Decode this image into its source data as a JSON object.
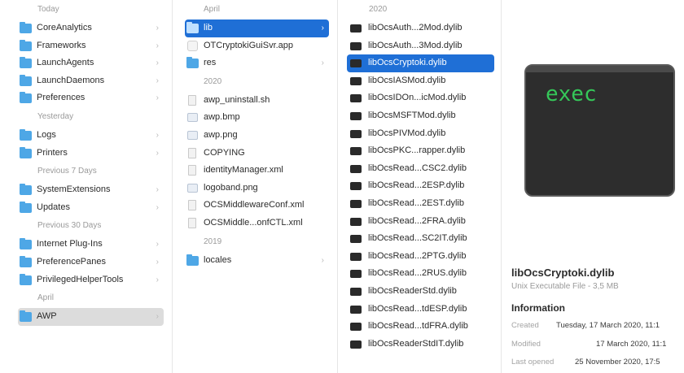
{
  "col1": {
    "groups": [
      {
        "label": "Today",
        "items": [
          {
            "name": "CoreAnalytics",
            "icon": "folder-icon"
          },
          {
            "name": "Frameworks",
            "icon": "folder-icon"
          },
          {
            "name": "LaunchAgents",
            "icon": "folder-icon"
          },
          {
            "name": "LaunchDaemons",
            "icon": "folder-icon"
          },
          {
            "name": "Preferences",
            "icon": "folder-icon"
          }
        ]
      },
      {
        "label": "Yesterday",
        "items": [
          {
            "name": "Logs",
            "icon": "folder-icon"
          },
          {
            "name": "Printers",
            "icon": "folder-icon"
          }
        ]
      },
      {
        "label": "Previous 7 Days",
        "items": [
          {
            "name": "SystemExtensions",
            "icon": "folder-icon"
          },
          {
            "name": "Updates",
            "icon": "folder-icon"
          }
        ]
      },
      {
        "label": "Previous 30 Days",
        "items": [
          {
            "name": "Internet Plug-Ins",
            "icon": "folder-icon"
          },
          {
            "name": "PreferencePanes",
            "icon": "folder-icon"
          },
          {
            "name": "PrivilegedHelperTools",
            "icon": "folder-icon"
          }
        ]
      },
      {
        "label": "April",
        "items": [
          {
            "name": "AWP",
            "icon": "folder-icon",
            "selected": "gray"
          }
        ]
      }
    ]
  },
  "col2": {
    "groups": [
      {
        "label": "April",
        "items": [
          {
            "name": "lib",
            "icon": "folder-icon",
            "selected": "blue",
            "chevron": true
          },
          {
            "name": "OTCryptokiGuiSvr.app",
            "icon": "app-icon"
          },
          {
            "name": "res",
            "icon": "folder-icon",
            "chevron": true
          }
        ]
      },
      {
        "label": "2020",
        "items": [
          {
            "name": "awp_uninstall.sh",
            "icon": "document-icon"
          },
          {
            "name": "awp.bmp",
            "icon": "image-icon"
          },
          {
            "name": "awp.png",
            "icon": "image-icon"
          },
          {
            "name": "COPYING",
            "icon": "document-icon"
          },
          {
            "name": "identityManager.xml",
            "icon": "document-icon"
          },
          {
            "name": "logoband.png",
            "icon": "image-icon"
          },
          {
            "name": "OCSMiddlewareConf.xml",
            "icon": "document-icon"
          },
          {
            "name": "OCSMiddle...onfCTL.xml",
            "icon": "document-icon"
          }
        ]
      },
      {
        "label": "2019",
        "items": [
          {
            "name": "locales",
            "icon": "folder-icon",
            "chevron": true
          }
        ]
      }
    ]
  },
  "col3": {
    "groups": [
      {
        "label": "2020",
        "items": [
          {
            "name": "libOcsAuth...2Mod.dylib",
            "icon": "executable-icon"
          },
          {
            "name": "libOcsAuth...3Mod.dylib",
            "icon": "executable-icon"
          },
          {
            "name": "libOcsCryptoki.dylib",
            "icon": "executable-icon",
            "selected": "blue"
          },
          {
            "name": "libOcsIASMod.dylib",
            "icon": "executable-icon"
          },
          {
            "name": "libOcsIDOn...icMod.dylib",
            "icon": "executable-icon"
          },
          {
            "name": "libOcsMSFTMod.dylib",
            "icon": "executable-icon"
          },
          {
            "name": "libOcsPIVMod.dylib",
            "icon": "executable-icon"
          },
          {
            "name": "libOcsPKC...rapper.dylib",
            "icon": "executable-icon"
          },
          {
            "name": "libOcsRead...CSC2.dylib",
            "icon": "executable-icon"
          },
          {
            "name": "libOcsRead...2ESP.dylib",
            "icon": "executable-icon"
          },
          {
            "name": "libOcsRead...2EST.dylib",
            "icon": "executable-icon"
          },
          {
            "name": "libOcsRead...2FRA.dylib",
            "icon": "executable-icon"
          },
          {
            "name": "libOcsRead...SC2IT.dylib",
            "icon": "executable-icon"
          },
          {
            "name": "libOcsRead...2PTG.dylib",
            "icon": "executable-icon"
          },
          {
            "name": "libOcsRead...2RUS.dylib",
            "icon": "executable-icon"
          },
          {
            "name": "libOcsReaderStd.dylib",
            "icon": "executable-icon"
          },
          {
            "name": "libOcsRead...tdESP.dylib",
            "icon": "executable-icon"
          },
          {
            "name": "libOcsRead...tdFRA.dylib",
            "icon": "executable-icon"
          },
          {
            "name": "libOcsReaderStdIT.dylib",
            "icon": "executable-icon"
          }
        ]
      }
    ]
  },
  "preview": {
    "icon_text": "exec",
    "file_name": "libOcsCryptoki.dylib",
    "file_kind": "Unix Executable File - 3,5 MB",
    "info_heading": "Information",
    "created_label": "Created",
    "created_value": "Tuesday, 17 March 2020, 11:1",
    "modified_label": "Modified",
    "modified_value": "17 March 2020, 11:1",
    "opened_label": "Last opened",
    "opened_value": "25 November 2020, 17:5"
  }
}
